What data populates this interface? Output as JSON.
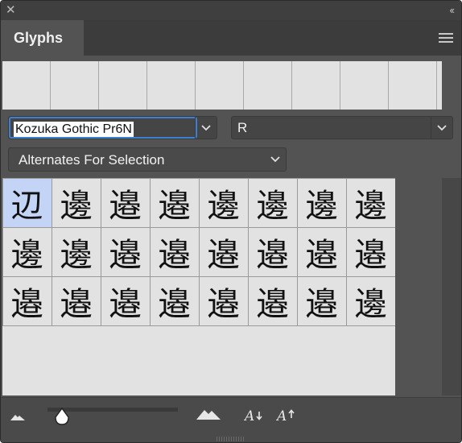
{
  "panel": {
    "close_glyph": "✕",
    "collapse_glyph": "‹‹",
    "tab_label": "Glyphs",
    "menu_icon": "hamburger-menu-icon"
  },
  "recent_glyphs": [
    "",
    "",
    "",
    "",
    "",
    "",
    "",
    "",
    ""
  ],
  "font_family": {
    "value": "Kozuka Gothic Pr6N"
  },
  "font_style": {
    "value": "R"
  },
  "show": {
    "value": "Alternates For Selection"
  },
  "glyphs": [
    "辺",
    "邊",
    "邉",
    "邉",
    "邊",
    "邊",
    "邊",
    "邊",
    "邊",
    "邊",
    "邉",
    "邉",
    "邉",
    "邉",
    "邉",
    "邉",
    "邉",
    "邉",
    "邉",
    "邉",
    "邉",
    "邉",
    "邉",
    "邊"
  ],
  "selected_index": 0,
  "bottom": {
    "zoom_out_icon": "small-mountain-icon",
    "zoom_in_icon": "large-mountain-icon",
    "zoom_level": 0.05,
    "decrease_size_icon": "font-size-decrease-icon",
    "increase_size_icon": "font-size-increase-icon"
  },
  "colors": {
    "panel_bg": "#535353",
    "grid_bg": "#e2e2e2",
    "selection": "#c3d4f6",
    "focus_ring": "#3e7fd0"
  }
}
